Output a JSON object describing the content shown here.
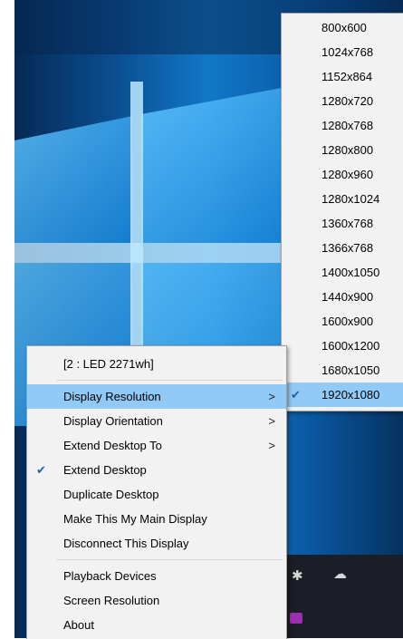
{
  "context_menu": {
    "header": "[2 : LED 2271wh]",
    "items": [
      {
        "label": "Display Resolution",
        "submenu": true,
        "highlighted": true,
        "checked": false
      },
      {
        "label": "Display Orientation",
        "submenu": true,
        "highlighted": false,
        "checked": false
      },
      {
        "label": "Extend Desktop To",
        "submenu": true,
        "highlighted": false,
        "checked": false
      },
      {
        "label": "Extend Desktop",
        "submenu": false,
        "highlighted": false,
        "checked": true
      },
      {
        "label": "Duplicate Desktop",
        "submenu": false,
        "highlighted": false,
        "checked": false
      },
      {
        "label": "Make This My Main Display",
        "submenu": false,
        "highlighted": false,
        "checked": false
      },
      {
        "label": "Disconnect This Display",
        "submenu": false,
        "highlighted": false,
        "checked": false
      }
    ],
    "footer_items": [
      {
        "label": "Playback Devices"
      },
      {
        "label": "Screen Resolution"
      },
      {
        "label": "About"
      }
    ],
    "arrow_glyph": ">",
    "check_glyph": "✔"
  },
  "resolution_submenu": {
    "options": [
      "800x600",
      "1024x768",
      "1152x864",
      "1280x720",
      "1280x768",
      "1280x800",
      "1280x960",
      "1280x1024",
      "1360x768",
      "1366x768",
      "1400x1050",
      "1440x900",
      "1600x900",
      "1600x1200",
      "1680x1050",
      "1920x1080"
    ],
    "selected": "1920x1080"
  },
  "taskbar": {
    "icons": [
      "bluetooth-icon",
      "onedrive-cloud-icon",
      "usb-device-icon"
    ]
  },
  "colors": {
    "highlight": "#91c9f7",
    "menu_bg": "#f2f2f2",
    "check": "#1e62b0",
    "wallpaper_blue": "#1178c8"
  }
}
